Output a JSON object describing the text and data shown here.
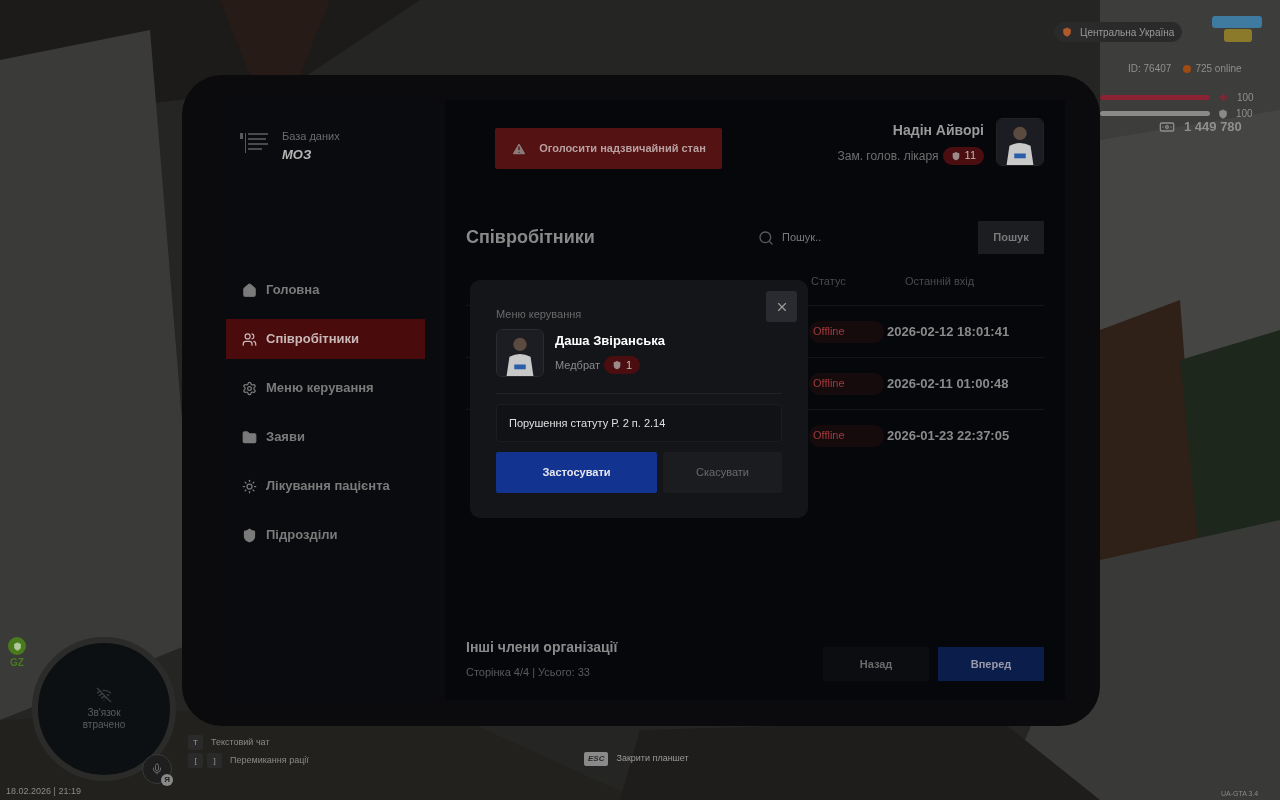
{
  "hud": {
    "region": "Центральна Україна",
    "server_id": "ID: 76407",
    "online": "725 online",
    "health": {
      "level": 1,
      "reading": "100"
    },
    "armor": {
      "level": 1,
      "reading": "100"
    },
    "money": "1 449 780",
    "zone": "GZ",
    "radar_text": "Зв'язок втрачено",
    "voice_key": "Я",
    "hints": [
      {
        "keys": [
          "T"
        ],
        "label": "Текстовий чат"
      },
      {
        "keys": [
          "[",
          "]"
        ],
        "label": "Перемикання рації"
      }
    ],
    "close_hint": {
      "key": "ESC",
      "label": "Закрити планшет"
    },
    "datetime": "18.02.2026 | 21:19",
    "version": "UA-GTA 3.4"
  },
  "tablet": {
    "brand": {
      "caption": "База даних",
      "title": "МОЗ"
    },
    "emergency_button": "Оголосити надзвичайний стан",
    "user": {
      "name": "Надін Айворі",
      "position": "Зам. голов. лікаря",
      "rank": "11"
    },
    "nav": [
      {
        "label": "Головна",
        "selected": false
      },
      {
        "label": "Співробітники",
        "selected": true
      },
      {
        "label": "Меню керування",
        "selected": false
      },
      {
        "label": "Заяви",
        "selected": false
      },
      {
        "label": "Лікування пацієнта",
        "selected": false
      },
      {
        "label": "Підрозділи",
        "selected": false
      }
    ],
    "page_title": "Співробітники",
    "search": {
      "placeholder": "Пошук.."
    },
    "search_button": "Пошук",
    "table": {
      "columns": [
        "Статус",
        "Останній вхід"
      ],
      "rows": [
        {
          "status": "Offline",
          "last_login": "2026-02-12 18:01:41"
        },
        {
          "status": "Offline",
          "last_login": "2026-02-11 01:00:48"
        },
        {
          "status": "Offline",
          "last_login": "2026-01-23 22:37:05"
        }
      ]
    },
    "footer": {
      "title": "Інші члени організації",
      "subtitle": "Сторінка 4/4 | Усього: 33",
      "back_button": "Назад",
      "next_button": "Вперед"
    },
    "modal": {
      "title": "Меню керування",
      "name": "Даша Звіранська",
      "position": "Медбрат",
      "rank": "1",
      "reason": "Порушення статуту Р. 2 п. 2.14",
      "apply_button": "Застосувати",
      "cancel_button": "Скасувати"
    }
  }
}
